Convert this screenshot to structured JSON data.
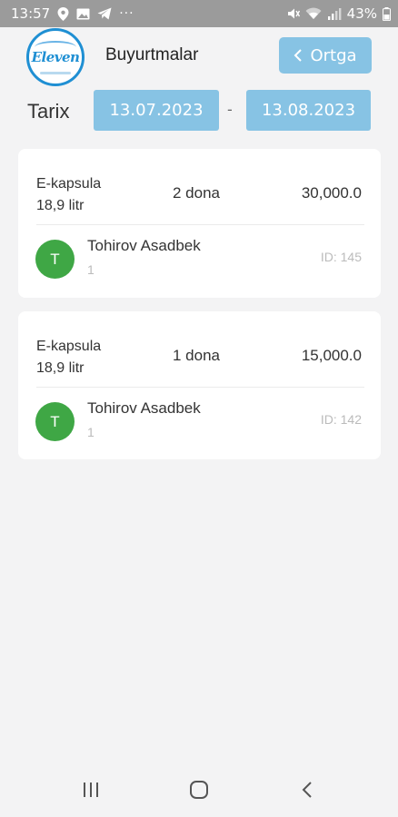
{
  "status_bar": {
    "time": "13:57",
    "dots": "···",
    "battery": "43%",
    "icons": [
      "location-icon",
      "image-icon",
      "telegram-icon",
      "mute-icon",
      "wifi-icon",
      "signal-icon",
      "battery-icon"
    ]
  },
  "header": {
    "logo_text": "Eleven",
    "title": "Buyurtmalar",
    "back_label": "Ortga"
  },
  "date_filter": {
    "label": "Tarix",
    "from": "13.07.2023",
    "separator": "-",
    "to": "13.08.2023"
  },
  "orders": [
    {
      "product_line1": "E-kapsula",
      "product_line2": "18,9 litr",
      "quantity": "2 dona",
      "price": "30,000.0",
      "avatar_letter": "T",
      "customer": "Tohirov Asadbek",
      "customer_sub": "1",
      "order_id": "ID: 145"
    },
    {
      "product_line1": "E-kapsula",
      "product_line2": "18,9 litr",
      "quantity": "1 dona",
      "price": "15,000.0",
      "avatar_letter": "T",
      "customer": "Tohirov Asadbek",
      "customer_sub": "1",
      "order_id": "ID: 142"
    }
  ],
  "colors": {
    "accent": "#87c3e4",
    "avatar": "#3fa745",
    "logo": "#1f8fd3",
    "statusbar": "#9b9b9b"
  }
}
